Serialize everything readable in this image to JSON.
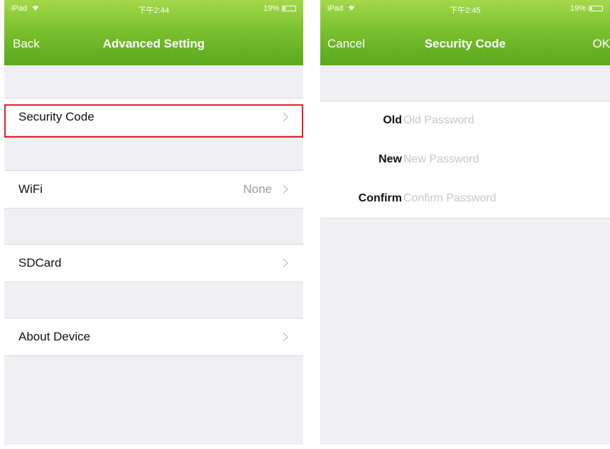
{
  "left_screen": {
    "status": {
      "carrier": "iPad",
      "time": "下午2:44",
      "battery": "19%",
      "battery_level": 0.19
    },
    "nav": {
      "back_label": "Back",
      "title": "Advanced Setting"
    },
    "rows": [
      {
        "label": "Security Code",
        "value": ""
      },
      {
        "label": "WiFi",
        "value": "None"
      },
      {
        "label": "SDCard",
        "value": ""
      },
      {
        "label": "About Device",
        "value": ""
      }
    ]
  },
  "right_screen": {
    "status": {
      "carrier": "iPad",
      "time": "下午2:45",
      "battery": "19%",
      "battery_level": 0.19
    },
    "nav": {
      "cancel_label": "Cancel",
      "title": "Security Code",
      "ok_label": "OK"
    },
    "fields": [
      {
        "label": "Old",
        "placeholder": "Old Password",
        "value": ""
      },
      {
        "label": "New",
        "placeholder": "New Password",
        "value": ""
      },
      {
        "label": "Confirm",
        "placeholder": "Confirm Password",
        "value": ""
      }
    ]
  },
  "colors": {
    "nav_green": "#7cc12e",
    "highlight_red": "#e8202a",
    "background_gray": "#efeff4"
  },
  "icons": [
    "wifi-icon",
    "battery-icon",
    "chevron-right-icon"
  ]
}
